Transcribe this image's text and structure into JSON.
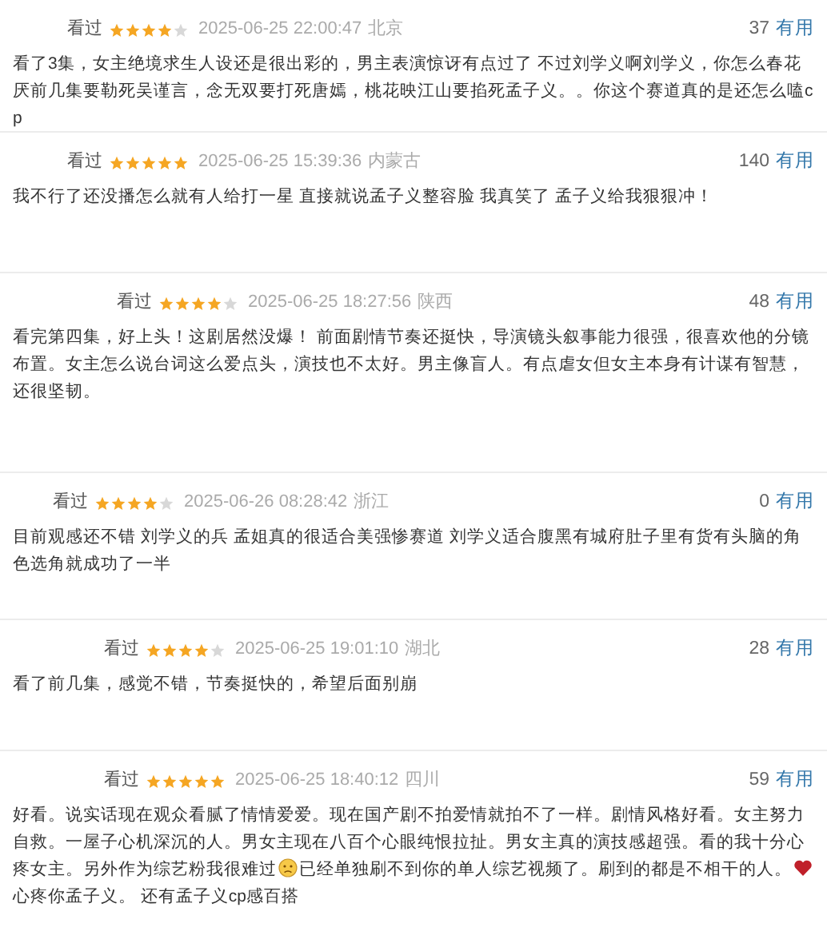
{
  "comments": [
    {
      "status": "看过",
      "stars": 4,
      "time": "2025-06-25 22:00:47",
      "location": "北京",
      "votes": "37",
      "useful": "有用",
      "body": [
        {
          "kind": "text",
          "text": "看了3集，女主绝境求生人设还是很出彩的，男主表演惊讶有点过了 不过刘学义啊刘学义，你怎么春花厌前几集要勒死吴谨言，念无双要打死唐嫣，桃花映江山要掐死孟子义。。你这个赛道真的是还怎么嗑cp"
        }
      ]
    },
    {
      "status": "看过",
      "stars": 5,
      "time": "2025-06-25 15:39:36",
      "location": "内蒙古",
      "votes": "140",
      "useful": "有用",
      "body": [
        {
          "kind": "text",
          "text": "我不行了还没播怎么就有人给打一星 直接就说孟子义整容脸 我真笑了 孟子义给我狠狠冲！"
        }
      ]
    },
    {
      "status": "看过",
      "stars": 4,
      "time": "2025-06-25 18:27:56",
      "location": "陕西",
      "votes": "48",
      "useful": "有用",
      "body": [
        {
          "kind": "text",
          "text": "看完第四集，好上头！这剧居然没爆！ 前面剧情节奏还挺快，导演镜头叙事能力很强，很喜欢他的分镜布置。女主怎么说台词这么爱点头，演技也不太好。男主像盲人。有点虐女但女主本身有计谋有智慧，还很坚韧。"
        }
      ]
    },
    {
      "status": "看过",
      "stars": 4,
      "time": "2025-06-26 08:28:42",
      "location": "浙江",
      "votes": "0",
      "useful": "有用",
      "body": [
        {
          "kind": "text",
          "text": "目前观感还不错 刘学义的兵 孟姐真的很适合美强惨赛道 刘学义适合腹黑有城府肚子里有货有头脑的角色选角就成功了一半"
        }
      ]
    },
    {
      "status": "看过",
      "stars": 4,
      "time": "2025-06-25 19:01:10",
      "location": "湖北",
      "votes": "28",
      "useful": "有用",
      "body": [
        {
          "kind": "text",
          "text": "看了前几集，感觉不错，节奏挺快的，希望后面别崩"
        }
      ]
    },
    {
      "status": "看过",
      "stars": 5,
      "time": "2025-06-25 18:40:12",
      "location": "四川",
      "votes": "59",
      "useful": "有用",
      "body": [
        {
          "kind": "text",
          "text": "好看。说实话现在观众看腻了情情爱爱。现在国产剧不拍爱情就拍不了一样。剧情风格好看。女主努力自救。一屋子心机深沉的人。男女主现在八百个心眼纯恨拉扯。男女主真的演技感超强。看的我十分心疼女主。另外作为综艺粉我很难过"
        },
        {
          "kind": "sad"
        },
        {
          "kind": "text",
          "text": "已经单独刷不到你的单人综艺视频了。刷到的都是不相干的人。"
        },
        {
          "kind": "heart"
        },
        {
          "kind": "text",
          "text": "心疼你孟子义。 还有孟子义cp感百搭"
        }
      ]
    }
  ]
}
